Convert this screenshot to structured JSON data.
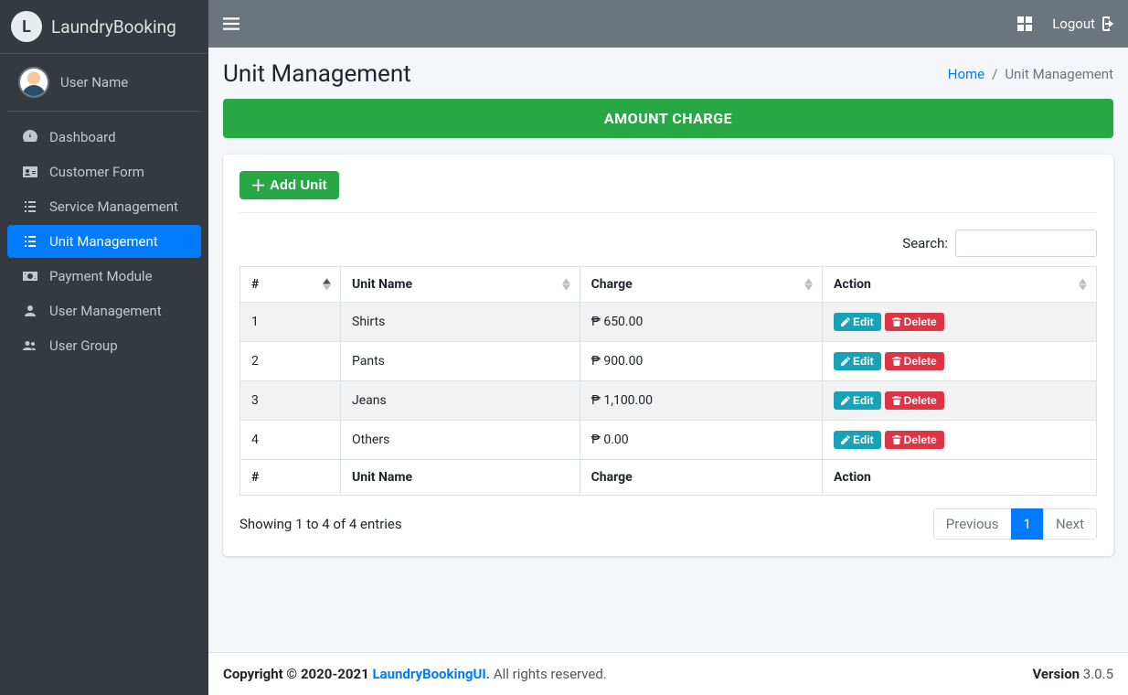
{
  "brand": {
    "initial": "L",
    "name": "LaundryBooking"
  },
  "user": {
    "name": "User Name"
  },
  "sidebar": {
    "items": [
      {
        "label": "Dashboard",
        "icon": "dashboard-icon",
        "active": false
      },
      {
        "label": "Customer Form",
        "icon": "id-card-icon",
        "active": false
      },
      {
        "label": "Service Management",
        "icon": "list-icon",
        "active": false
      },
      {
        "label": "Unit Management",
        "icon": "list-icon",
        "active": true
      },
      {
        "label": "Payment Module",
        "icon": "money-icon",
        "active": false
      },
      {
        "label": "User Management",
        "icon": "user-icon",
        "active": false
      },
      {
        "label": "User Group",
        "icon": "users-icon",
        "active": false
      }
    ]
  },
  "topbar": {
    "logout_label": "Logout"
  },
  "header": {
    "title": "Unit Management",
    "breadcrumb": {
      "home": "Home",
      "current": "Unit Management"
    }
  },
  "banner": "AMOUNT CHARGE",
  "buttons": {
    "add_unit": "Add Unit",
    "edit": "Edit",
    "delete": "Delete"
  },
  "table": {
    "search_label": "Search:",
    "columns": [
      "#",
      "Unit Name",
      "Charge",
      "Action"
    ],
    "rows": [
      {
        "num": "1",
        "name": "Shirts",
        "charge": "₱ 650.00"
      },
      {
        "num": "2",
        "name": "Pants",
        "charge": "₱ 900.00"
      },
      {
        "num": "3",
        "name": "Jeans",
        "charge": "₱ 1,100.00"
      },
      {
        "num": "4",
        "name": "Others",
        "charge": "₱ 0.00"
      }
    ],
    "info": "Showing 1 to 4 of 4 entries",
    "pagination": {
      "previous": "Previous",
      "page": "1",
      "next": "Next"
    }
  },
  "footer": {
    "copyright_prefix": "Copyright © 2020-2021 ",
    "brand": "LaundryBookingUI.",
    "rights": " All rights reserved.",
    "version_label": "Version",
    "version": " 3.0.5"
  }
}
